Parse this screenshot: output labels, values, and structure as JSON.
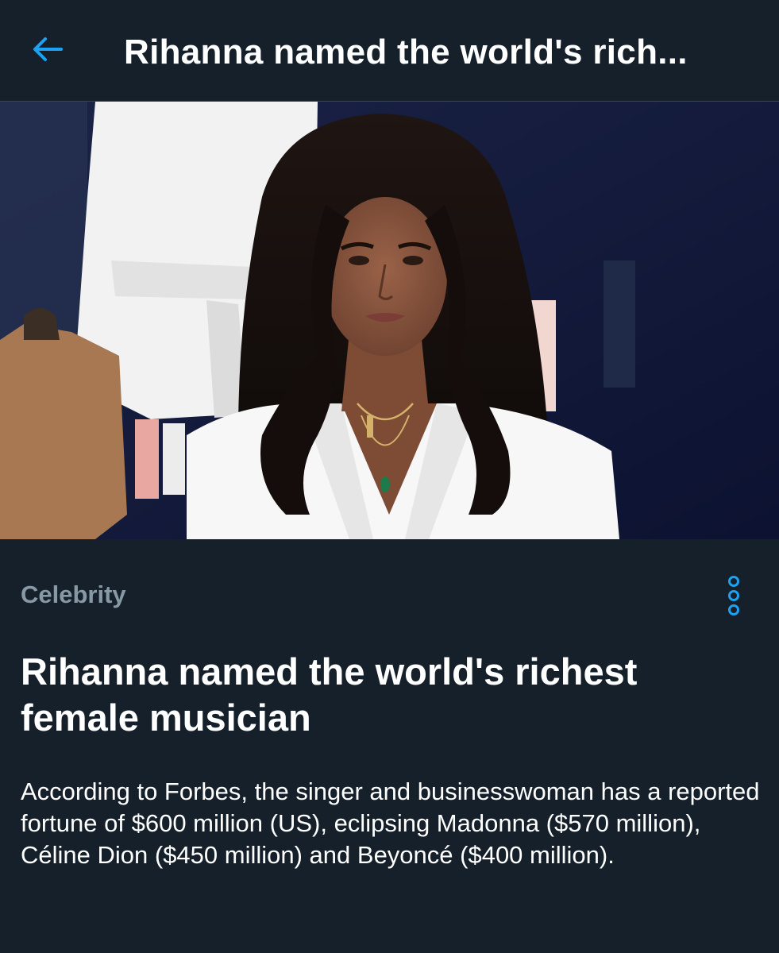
{
  "header": {
    "back_icon": "back-arrow-icon",
    "title": "Rihanna named the world's rich..."
  },
  "colors": {
    "background": "#15202b",
    "accent": "#1da1f2",
    "secondary_text": "#8899a6",
    "primary_text": "#ffffff"
  },
  "hero_image": {
    "description_icon": "photo"
  },
  "article": {
    "category": "Celebrity",
    "more_icon": "more-options-icon",
    "headline": "Rihanna named the world's richest female musician",
    "summary": "According to Forbes, the singer and businesswoman has a reported fortune of $600 million (US), eclipsing Madonna ($570 million), Céline Dion ($450 million) and Beyoncé ($400 million)."
  }
}
